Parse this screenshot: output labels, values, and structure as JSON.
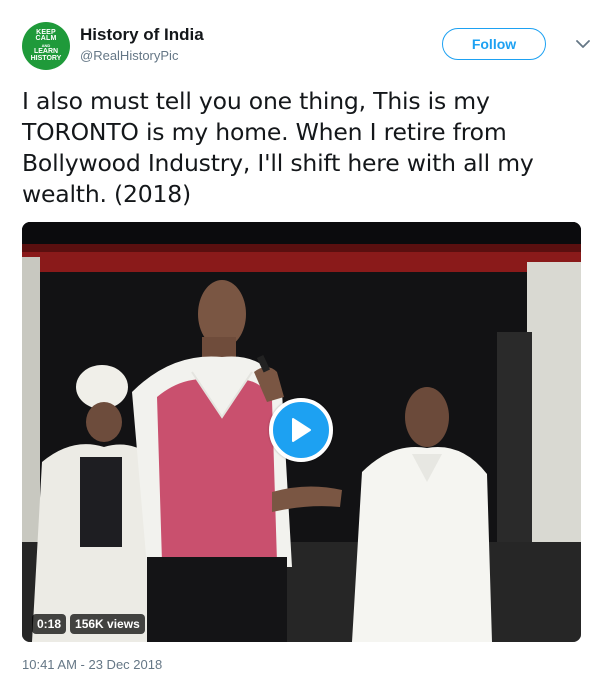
{
  "user": {
    "display_name": "History of India",
    "handle": "@RealHistoryPic",
    "avatar_lines": [
      "KEEP",
      "CALM",
      "AND",
      "LEARN",
      "HISTORY"
    ],
    "avatar_color": "#1f9a3a"
  },
  "actions": {
    "follow_label": "Follow",
    "more_icon": "chevron-down-icon"
  },
  "tweet": {
    "text": "I also must tell you one thing, This is my TORONTO is my home. When I retire from Bollywood Industry, I'll shift here with all my wealth. (2018)",
    "timestamp": "10:41 AM - 23 Dec 2018"
  },
  "video": {
    "duration": "0:18",
    "views": "156K views",
    "play_icon": "play-icon"
  },
  "colors": {
    "accent": "#1da1f2",
    "secondary_text": "#657786",
    "primary_text": "#14171a"
  }
}
